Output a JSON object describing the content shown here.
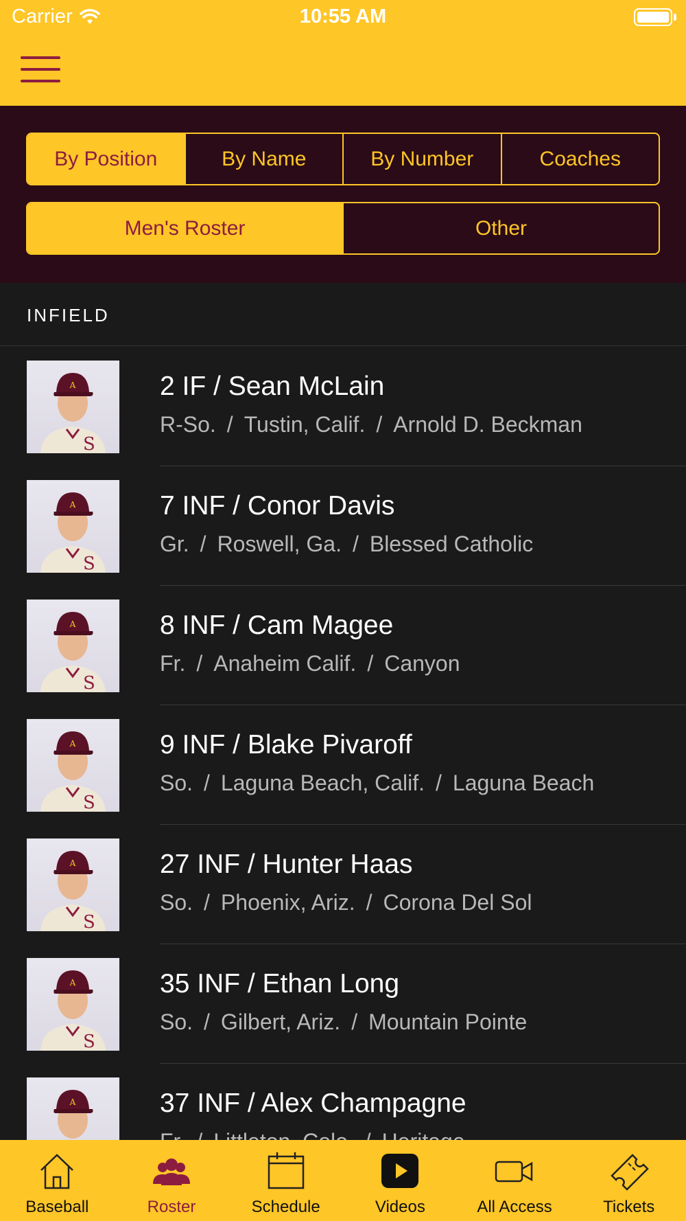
{
  "status": {
    "carrier": "Carrier",
    "time": "10:55 AM"
  },
  "header": {
    "menu_icon": "hamburger-menu-icon"
  },
  "colors": {
    "gold": "#FFC627",
    "maroon": "#8C1D40",
    "dark": "#2a0b17"
  },
  "filters": {
    "row1": [
      "By Position",
      "By Name",
      "By Number",
      "Coaches"
    ],
    "row2": [
      "Men's Roster",
      "Other"
    ]
  },
  "section": {
    "title": "INFIELD"
  },
  "players": [
    {
      "title": "2 IF / Sean McLain",
      "class": "R-So.",
      "hometown": "Tustin, Calif.",
      "school": "Arnold D. Beckman"
    },
    {
      "title": "7 INF / Conor Davis",
      "class": "Gr.",
      "hometown": "Roswell, Ga.",
      "school": "Blessed Catholic"
    },
    {
      "title": "8 INF / Cam Magee",
      "class": "Fr.",
      "hometown": "Anaheim Calif.",
      "school": "Canyon"
    },
    {
      "title": "9 INF / Blake Pivaroff",
      "class": "So.",
      "hometown": "Laguna Beach, Calif.",
      "school": "Laguna Beach"
    },
    {
      "title": "27 INF / Hunter Haas",
      "class": "So.",
      "hometown": "Phoenix, Ariz.",
      "school": "Corona Del Sol"
    },
    {
      "title": "35 INF / Ethan Long",
      "class": "So.",
      "hometown": "Gilbert, Ariz.",
      "school": "Mountain Pointe"
    },
    {
      "title": "37 INF / Alex Champagne",
      "class": "Fr.",
      "hometown": "Littleton, Colo.",
      "school": "Heritage"
    }
  ],
  "tabs": [
    {
      "label": "Baseball",
      "icon": "home-icon"
    },
    {
      "label": "Roster",
      "icon": "people-icon"
    },
    {
      "label": "Schedule",
      "icon": "calendar-icon"
    },
    {
      "label": "Videos",
      "icon": "play-icon"
    },
    {
      "label": "All Access",
      "icon": "video-camera-icon"
    },
    {
      "label": "Tickets",
      "icon": "ticket-icon"
    }
  ]
}
